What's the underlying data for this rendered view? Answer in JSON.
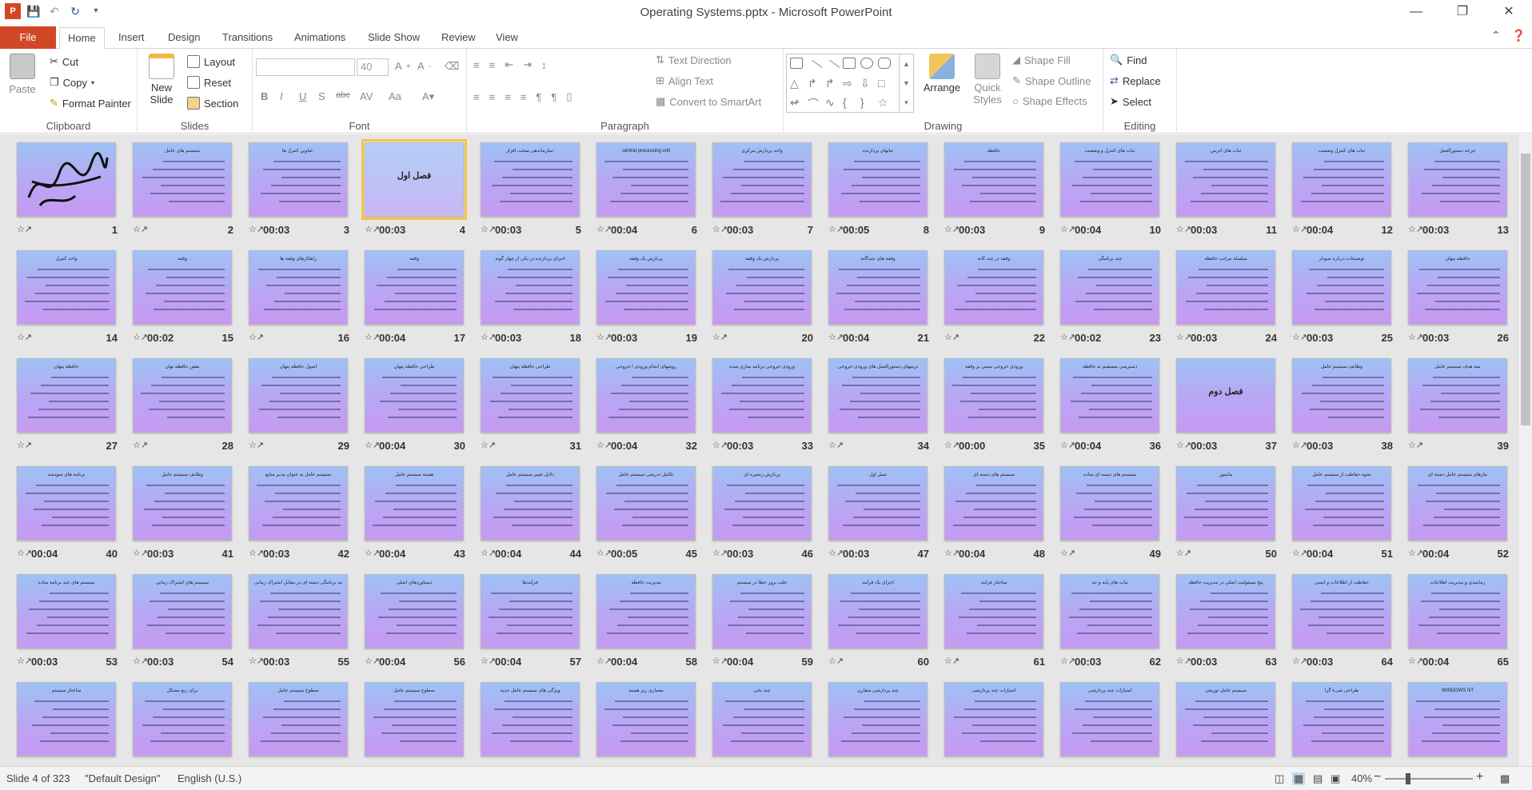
{
  "window": {
    "title": "Operating Systems.pptx - Microsoft PowerPoint"
  },
  "ribbon_tabs": [
    "File",
    "Home",
    "Insert",
    "Design",
    "Transitions",
    "Animations",
    "Slide Show",
    "Review",
    "View"
  ],
  "ribbon": {
    "clipboard": {
      "paste": "Paste",
      "cut": "Cut",
      "copy": "Copy",
      "format_painter": "Format Painter",
      "label": "Clipboard"
    },
    "slides": {
      "new_slide_l1": "New",
      "new_slide_l2": "Slide",
      "layout": "Layout",
      "reset": "Reset",
      "section": "Section",
      "label": "Slides"
    },
    "font": {
      "font_size": "40",
      "label": "Font",
      "bold": "B",
      "italic": "I",
      "underline": "U",
      "strike": "S",
      "abc": "abc",
      "case": "Aa"
    },
    "paragraph": {
      "text_direction": "Text Direction",
      "align_text": "Align Text",
      "convert_smartart": "Convert to SmartArt",
      "label": "Paragraph"
    },
    "drawing": {
      "arrange": "Arrange",
      "quick_styles_l1": "Quick",
      "quick_styles_l2": "Styles",
      "shape_fill": "Shape Fill",
      "shape_outline": "Shape Outline",
      "shape_effects": "Shape Effects",
      "label": "Drawing"
    },
    "editing": {
      "find": "Find",
      "replace": "Replace",
      "select": "Select",
      "label": "Editing"
    }
  },
  "slides": [
    {
      "num": "1",
      "time": "",
      "title": "",
      "logo": true
    },
    {
      "num": "2",
      "time": "",
      "title": "سیستم های عامل"
    },
    {
      "num": "3",
      "time": "00:03",
      "title": "عناوین کنترل ها:"
    },
    {
      "num": "4",
      "time": "00:03",
      "title": "فصل اول",
      "big": true,
      "sel": true
    },
    {
      "num": "5",
      "time": "00:03",
      "title": "سازماندهی سخت افزار:"
    },
    {
      "num": "6",
      "time": "00:04",
      "title": "central processing unit"
    },
    {
      "num": "7",
      "time": "00:03",
      "title": "واحد پردازش مرکزی"
    },
    {
      "num": "8",
      "time": "00:05",
      "title": "ثباتهای پردازنده"
    },
    {
      "num": "9",
      "time": "00:03",
      "title": "حافظه"
    },
    {
      "num": "10",
      "time": "00:04",
      "title": "ثبات های کنترل و وضعیت"
    },
    {
      "num": "11",
      "time": "00:03",
      "title": "ثبات های آدرس"
    },
    {
      "num": "12",
      "time": "00:04",
      "title": "ثبات های کنترل وضعیت"
    },
    {
      "num": "13",
      "time": "00:03",
      "title": "چرخه دستورالعمل"
    },
    {
      "num": "14",
      "time": "",
      "title": "واحد کنترل"
    },
    {
      "num": "15",
      "time": "00:02",
      "title": "وقفه"
    },
    {
      "num": "16",
      "time": "",
      "title": "راهکارهای وقفه ها"
    },
    {
      "num": "17",
      "time": "00:04",
      "title": "وقفه"
    },
    {
      "num": "18",
      "time": "00:03",
      "title": "اجرای پردازنده در یکی از چهار گونه"
    },
    {
      "num": "19",
      "time": "00:03",
      "title": "پردازش یک وقفه"
    },
    {
      "num": "20",
      "time": "",
      "title": "پردازش یک وقفه"
    },
    {
      "num": "21",
      "time": "00:04",
      "title": "وقفه های چندگانه"
    },
    {
      "num": "22",
      "time": "",
      "title": "وقفه در چند کانه"
    },
    {
      "num": "23",
      "time": "00:02",
      "title": "چند برنامگی"
    },
    {
      "num": "24",
      "time": "00:03",
      "title": "سلسله مراتب حافظه"
    },
    {
      "num": "25",
      "time": "00:03",
      "title": "توضیحات درباره نمودار"
    },
    {
      "num": "26",
      "time": "00:03",
      "title": "حافظه پنهان"
    },
    {
      "num": "27",
      "time": "",
      "title": "حافظه پنهان"
    },
    {
      "num": "28",
      "time": "",
      "title": "نقش حافظه نهان"
    },
    {
      "num": "29",
      "time": "",
      "title": "اصول حافظه پنهان"
    },
    {
      "num": "30",
      "time": "00:04",
      "title": "طراحی حافظه پنهان"
    },
    {
      "num": "31",
      "time": "",
      "title": "طراحی حافظه پنهان"
    },
    {
      "num": "32",
      "time": "00:04",
      "title": "روشهای انجام ورودی / خروجی"
    },
    {
      "num": "33",
      "time": "00:03",
      "title": "ورودی خروجی برنامه سازی شده"
    },
    {
      "num": "34",
      "time": "",
      "title": "ترتیبهای دستورالعمل های ورودی خروجی"
    },
    {
      "num": "35",
      "time": "00:00",
      "title": "ورودی خروجی مبتنی بر وقفه"
    },
    {
      "num": "36",
      "time": "00:04",
      "title": "دسترسی مستقیم به حافظه"
    },
    {
      "num": "37",
      "time": "00:03",
      "title": "فصل دوم",
      "big": true
    },
    {
      "num": "38",
      "time": "00:03",
      "title": "وظایف سیستم عامل"
    },
    {
      "num": "39",
      "time": "",
      "title": "سه هدف سیستم عامل"
    },
    {
      "num": "40",
      "time": "00:04",
      "title": "برنامه های سودمند"
    },
    {
      "num": "41",
      "time": "00:03",
      "title": "وظایف سیستم عامل"
    },
    {
      "num": "42",
      "time": "00:03",
      "title": "سیستم عامل به عنوان مدیر منابع"
    },
    {
      "num": "43",
      "time": "00:04",
      "title": "هسته سیستم عامل"
    },
    {
      "num": "44",
      "time": "00:04",
      "title": "دلایل تغییر سیستم عامل"
    },
    {
      "num": "45",
      "time": "00:05",
      "title": "تکامل تدریجی سیستم عامل"
    },
    {
      "num": "46",
      "time": "00:03",
      "title": "پردازش زنجیره ای"
    },
    {
      "num": "47",
      "time": "00:03",
      "title": "نسل اول"
    },
    {
      "num": "48",
      "time": "00:04",
      "title": "سیستم های دسته ای"
    },
    {
      "num": "49",
      "time": "",
      "title": "سیستم های دسته ای ساده"
    },
    {
      "num": "50",
      "time": "",
      "title": "مانیتور"
    },
    {
      "num": "51",
      "time": "00:04",
      "title": "نحوه حفاظت از سیستم عامل"
    },
    {
      "num": "52",
      "time": "00:04",
      "title": "نیازهای سیستم عامل دسته ای"
    },
    {
      "num": "53",
      "time": "00:03",
      "title": "سیستم های چند برنامه ساده"
    },
    {
      "num": "54",
      "time": "00:03",
      "title": "سیستم های اشتراک زمانی"
    },
    {
      "num": "55",
      "time": "00:03",
      "title": "چند برنامگی دسته ای در مقابل اشتراک زمانی"
    },
    {
      "num": "56",
      "time": "00:04",
      "title": "دستاوردهای اصلی"
    },
    {
      "num": "57",
      "time": "00:04",
      "title": "فرآیندها"
    },
    {
      "num": "58",
      "time": "00:04",
      "title": "مدیریت حافظه"
    },
    {
      "num": "59",
      "time": "00:04",
      "title": "علت بروز خطا در سیستم"
    },
    {
      "num": "60",
      "time": "",
      "title": "اجزای یک فرآیند"
    },
    {
      "num": "61",
      "time": "",
      "title": "ساختار فرآیند"
    },
    {
      "num": "62",
      "time": "00:03",
      "title": "ثبات های پایه و حد"
    },
    {
      "num": "63",
      "time": "00:03",
      "title": "پنج مسئولیت اصلی در مدیریت حافظه"
    },
    {
      "num": "64",
      "time": "00:03",
      "title": "حفاظت از اطلاعات و ایمنی"
    },
    {
      "num": "65",
      "time": "00:04",
      "title": "زمانبندی و مدیریت اطلاعات"
    },
    {
      "num": "",
      "time": "",
      "title": "ساختار سیستم"
    },
    {
      "num": "",
      "time": "",
      "title": "برای ربع مشکل"
    },
    {
      "num": "",
      "time": "",
      "title": "سطوح سیستم عامل"
    },
    {
      "num": "",
      "time": "",
      "title": "سطوح سیستم عامل"
    },
    {
      "num": "",
      "time": "",
      "title": "ویژگی های سیستم عامل جدید"
    },
    {
      "num": "",
      "time": "",
      "title": "معماری ریز هسته"
    },
    {
      "num": "",
      "time": "",
      "title": "چند نخی"
    },
    {
      "num": "",
      "time": "",
      "title": "چند پردازشی متقارن"
    },
    {
      "num": "",
      "time": "",
      "title": "امتیازات چند پردازشی"
    },
    {
      "num": "",
      "time": "",
      "title": "امتیازات چند پردازشی"
    },
    {
      "num": "",
      "time": "",
      "title": "سیستم عامل توزیعی"
    },
    {
      "num": "",
      "time": "",
      "title": "طراحی شیء گرا"
    },
    {
      "num": "",
      "time": "",
      "title": "WINDOWS NT"
    }
  ],
  "status": {
    "slide_info": "Slide 4 of 323",
    "theme": "\"Default Design\"",
    "language": "English (U.S.)",
    "zoom": "40%",
    "zoom_minus": "−",
    "zoom_plus": "+"
  }
}
